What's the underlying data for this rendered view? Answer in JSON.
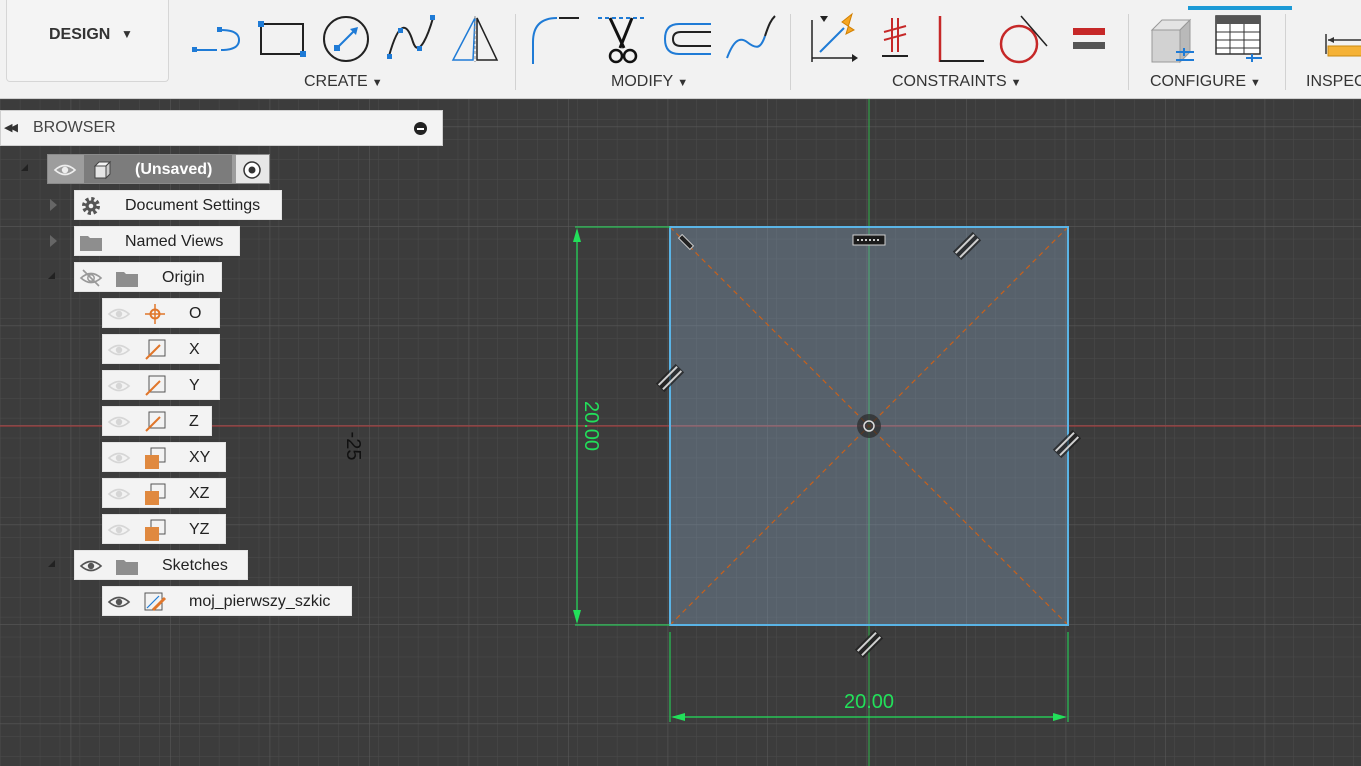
{
  "toolbar": {
    "workspace": "DESIGN",
    "groups": {
      "create": "CREATE",
      "modify": "MODIFY",
      "constraints": "CONSTRAINTS",
      "configure": "CONFIGURE",
      "inspect": "INSPEC"
    }
  },
  "browser": {
    "title": "BROWSER",
    "root": "(Unsaved)",
    "document_settings": "Document Settings",
    "named_views": "Named Views",
    "origin": "Origin",
    "origin_items": [
      "O",
      "X",
      "Y",
      "Z",
      "XY",
      "XZ",
      "YZ"
    ],
    "sketches": "Sketches",
    "sketch_name": "moj_pierwszy_szkic"
  },
  "canvas": {
    "axis_value": "-25",
    "dim_vertical": "20.00",
    "dim_horizontal": "20.00"
  },
  "colors": {
    "dimension": "#22e05a",
    "sketch_line": "#5ab4e6",
    "construction": "#c8611b",
    "axis_red": "#b83a3a",
    "axis_green": "#2fb34a",
    "accent": "#1c9ad6"
  }
}
